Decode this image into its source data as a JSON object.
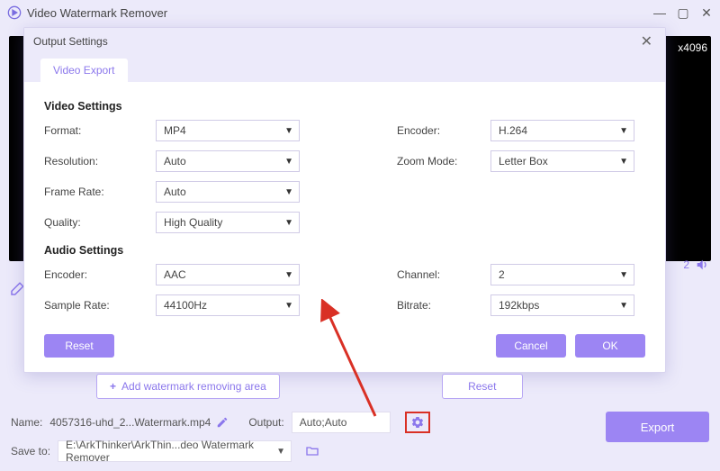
{
  "app": {
    "title": "Video Watermark Remover"
  },
  "preview": {
    "dimensions": "x4096",
    "timeValue": "2"
  },
  "dialog": {
    "title": "Output Settings",
    "tab": "Video Export",
    "videoSectionTitle": "Video Settings",
    "audioSectionTitle": "Audio Settings",
    "labels": {
      "format": "Format:",
      "encoderV": "Encoder:",
      "resolution": "Resolution:",
      "zoom": "Zoom Mode:",
      "frameRate": "Frame Rate:",
      "quality": "Quality:",
      "encoderA": "Encoder:",
      "channel": "Channel:",
      "sampleRate": "Sample Rate:",
      "bitrate": "Bitrate:"
    },
    "values": {
      "format": "MP4",
      "encoderV": "H.264",
      "resolution": "Auto",
      "zoom": "Letter Box",
      "frameRate": "Auto",
      "quality": "High Quality",
      "encoderA": "AAC",
      "channel": "2",
      "sampleRate": "44100Hz",
      "bitrate": "192kbps"
    },
    "buttons": {
      "reset": "Reset",
      "cancel": "Cancel",
      "ok": "OK"
    }
  },
  "bottom": {
    "addArea": "Add watermark removing area",
    "reset": "Reset",
    "nameLabel": "Name:",
    "nameValue": "4057316-uhd_2...Watermark.mp4",
    "outputLabel": "Output:",
    "outputValue": "Auto;Auto",
    "saveLabel": "Save to:",
    "savePath": "E:\\ArkThinker\\ArkThin...deo Watermark Remover",
    "export": "Export"
  }
}
